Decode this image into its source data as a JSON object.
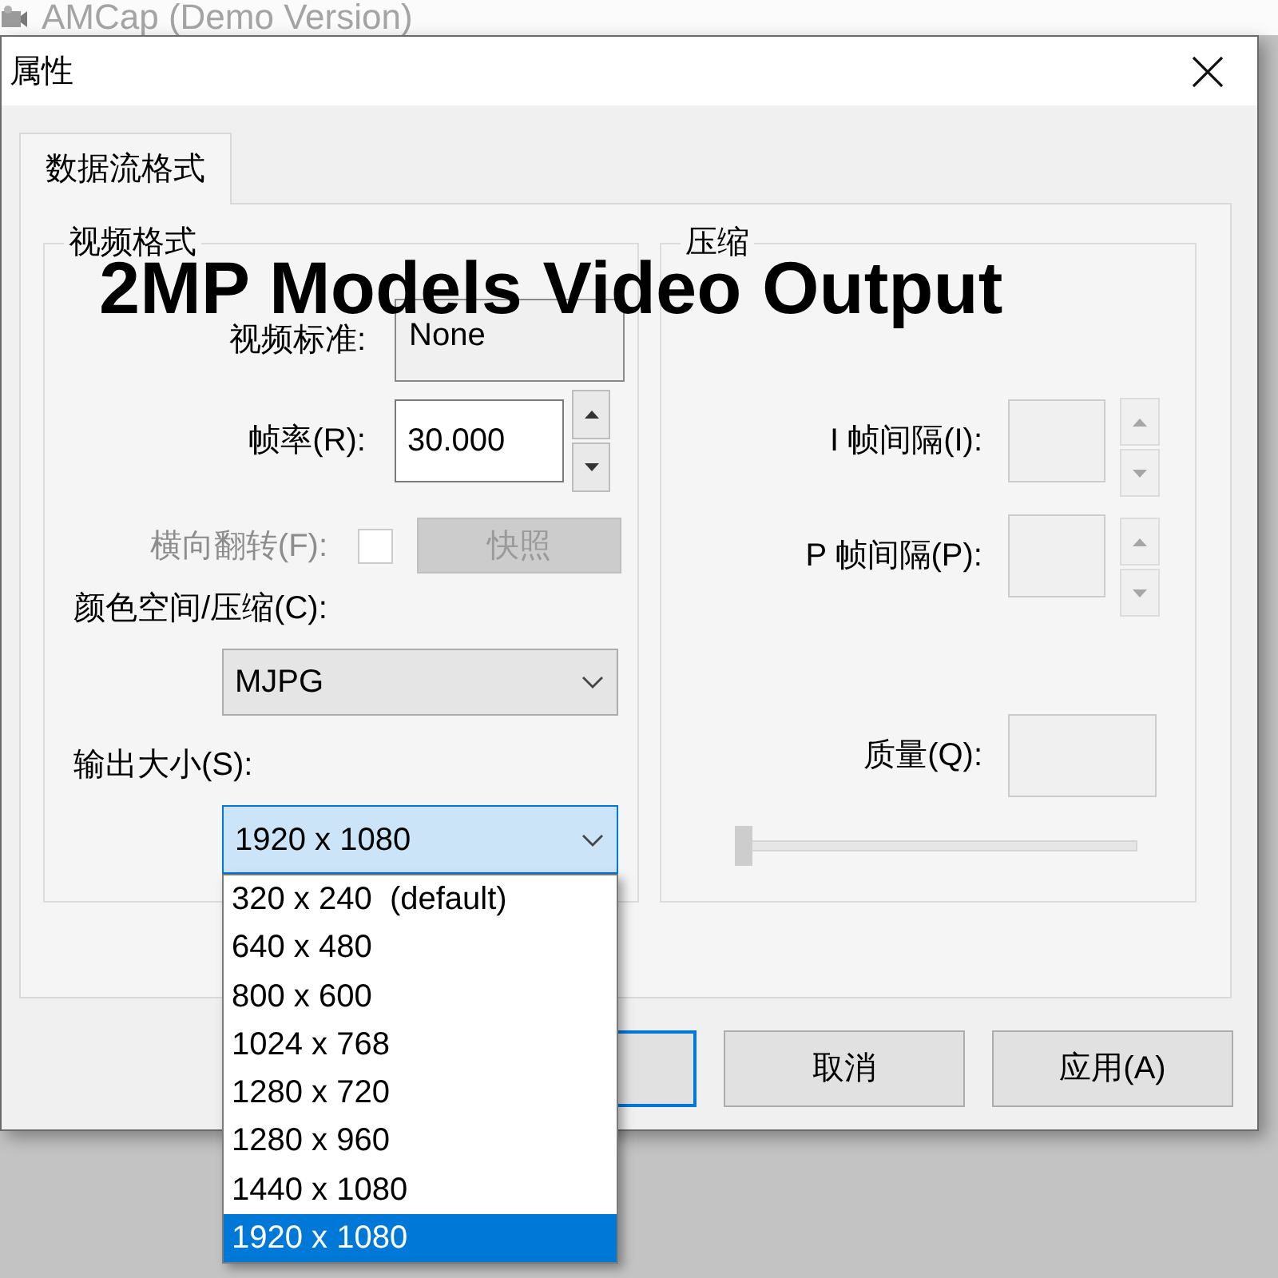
{
  "background_window": {
    "title": "AMCap (Demo Version)"
  },
  "dialog": {
    "title": "属性"
  },
  "tabs": [
    {
      "label": "数据流格式",
      "selected": true
    }
  ],
  "video_format": {
    "title": "视频格式",
    "video_standard": {
      "label": "视频标准:",
      "value": "None"
    },
    "frame_rate": {
      "label": "帧率(R):",
      "value": "30.000",
      "disabled": false
    },
    "flip_horizontal": {
      "label": "横向翻转(F):",
      "checked": false,
      "disabled": true
    },
    "snapshot_button": {
      "label": "快照",
      "disabled": true
    },
    "color_space": {
      "label": "颜色空间/压缩(C):",
      "value": "MJPG"
    },
    "output_size": {
      "label": "输出大小(S):",
      "value": "1920 x 1080",
      "expanded": true,
      "options": [
        {
          "label": "320 x 240  (default)",
          "selected": false
        },
        {
          "label": "640 x 480",
          "selected": false
        },
        {
          "label": "800 x 600",
          "selected": false
        },
        {
          "label": "1024 x 768",
          "selected": false
        },
        {
          "label": "1280 x 720",
          "selected": false
        },
        {
          "label": "1280 x 960",
          "selected": false
        },
        {
          "label": "1440 x 1080",
          "selected": false
        },
        {
          "label": "1920 x 1080",
          "selected": true
        }
      ]
    }
  },
  "compression": {
    "title": "压缩",
    "i_frame_interval": {
      "label": "I 帧间隔(I):",
      "disabled": true
    },
    "p_frame_interval": {
      "label": "P 帧间隔(P):",
      "disabled": true
    },
    "quality": {
      "label": "质量(Q):",
      "disabled": true,
      "level": 0
    }
  },
  "buttons": [
    {
      "focused": true
    },
    {
      "label": "取消",
      "focused": false
    },
    {
      "label": "应用(A)",
      "focused": false
    }
  ],
  "caption": "2MP Models Video Output"
}
